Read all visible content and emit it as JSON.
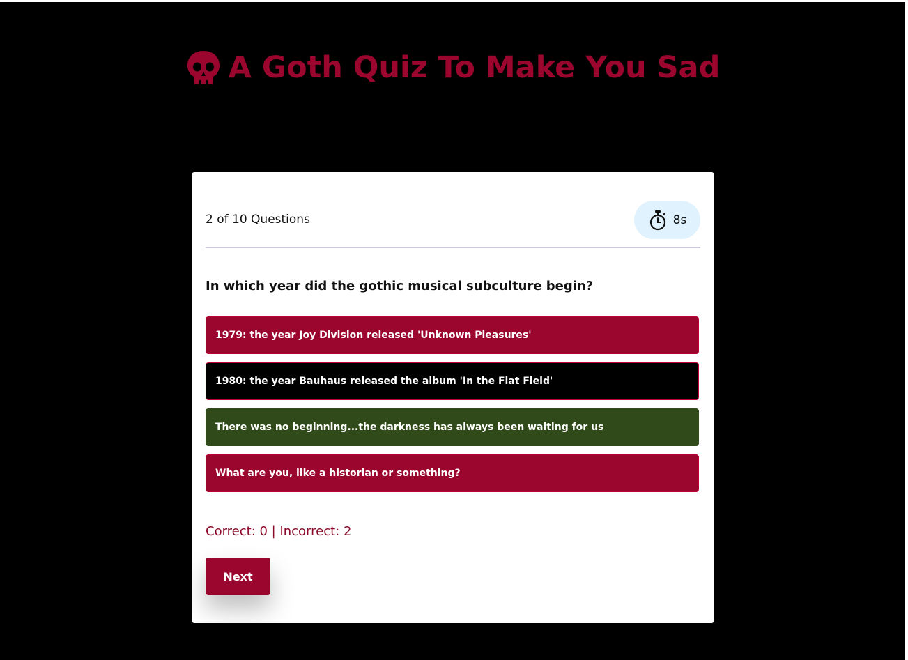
{
  "header": {
    "title": "A Goth Quiz To Make You Sad",
    "icon": "skull-icon",
    "accent_color": "#9b062e"
  },
  "quiz": {
    "progress_text": "2 of 10 Questions",
    "timer": {
      "icon": "stopwatch-icon",
      "value": "8s"
    },
    "question": "In which year did the gothic musical subculture begin?",
    "options": [
      {
        "label": "1979: the year Joy Division released 'Unknown Pleasures'",
        "state": "incorrect",
        "color": "#9b062e"
      },
      {
        "label": "1980: the year Bauhaus released the album 'In the Flat Field'",
        "state": "neutral",
        "color": "#000000"
      },
      {
        "label": "There was no beginning...the darkness has always been waiting for us",
        "state": "correct",
        "color": "#314a1a"
      },
      {
        "label": "What are you, like a historian or something?",
        "state": "incorrect",
        "color": "#9b062e"
      }
    ],
    "score_text": "Correct: 0 | Incorrect: 2",
    "next_label": "Next"
  }
}
